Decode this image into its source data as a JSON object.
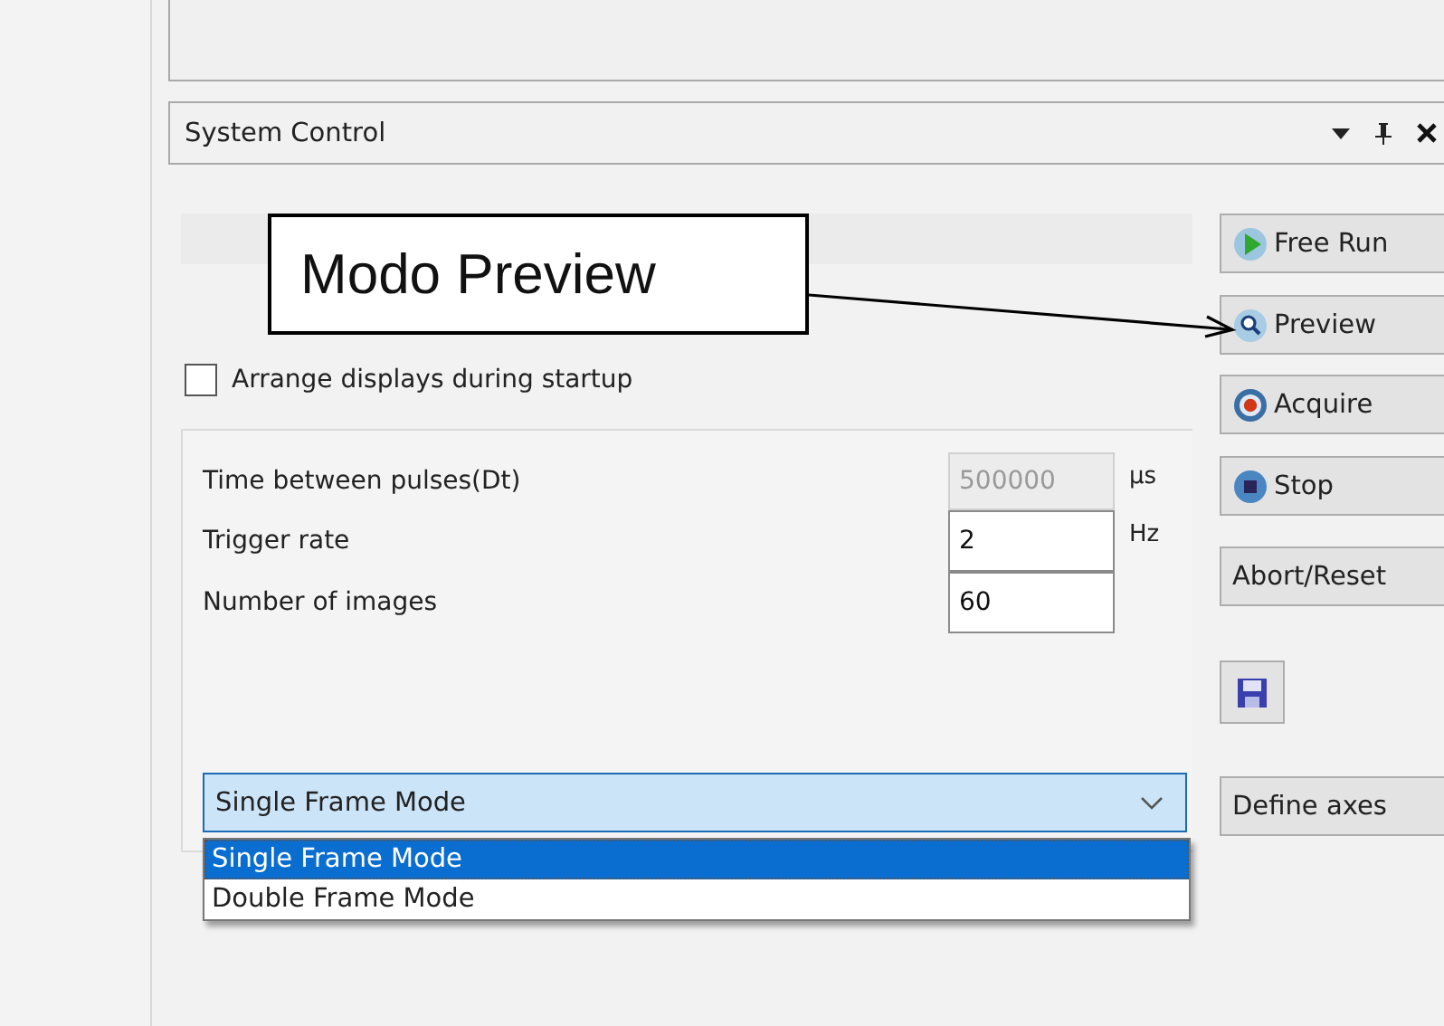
{
  "panel": {
    "title": "System Control"
  },
  "annotation": {
    "text": "Modo Preview"
  },
  "startup_option": {
    "label": "Arrange displays during startup",
    "checked": false
  },
  "parameters": [
    {
      "label": "Time between pulses(Dt)",
      "value": "500000",
      "unit": "µs",
      "disabled": true
    },
    {
      "label": "Trigger rate",
      "value": "2",
      "unit": "Hz",
      "disabled": false
    },
    {
      "label": "Number of images",
      "value": "60",
      "disabled": false
    }
  ],
  "frame_mode": {
    "value": "Single Frame Mode",
    "expanded": true,
    "options": [
      {
        "label": "Single Frame Mode",
        "selected": true
      },
      {
        "label": "Double Frame Mode",
        "selected": false
      }
    ]
  },
  "buttons": [
    {
      "kind": "run",
      "label": "Free Run"
    },
    {
      "kind": "preview",
      "label": "Preview"
    },
    {
      "kind": "acquire",
      "label": "Acquire"
    },
    {
      "kind": "stop",
      "label": "Stop"
    },
    {
      "kind": "plain",
      "label": "Abort/Reset"
    },
    {
      "kind": "save"
    },
    {
      "kind": "plain",
      "label": "Define axes"
    }
  ]
}
